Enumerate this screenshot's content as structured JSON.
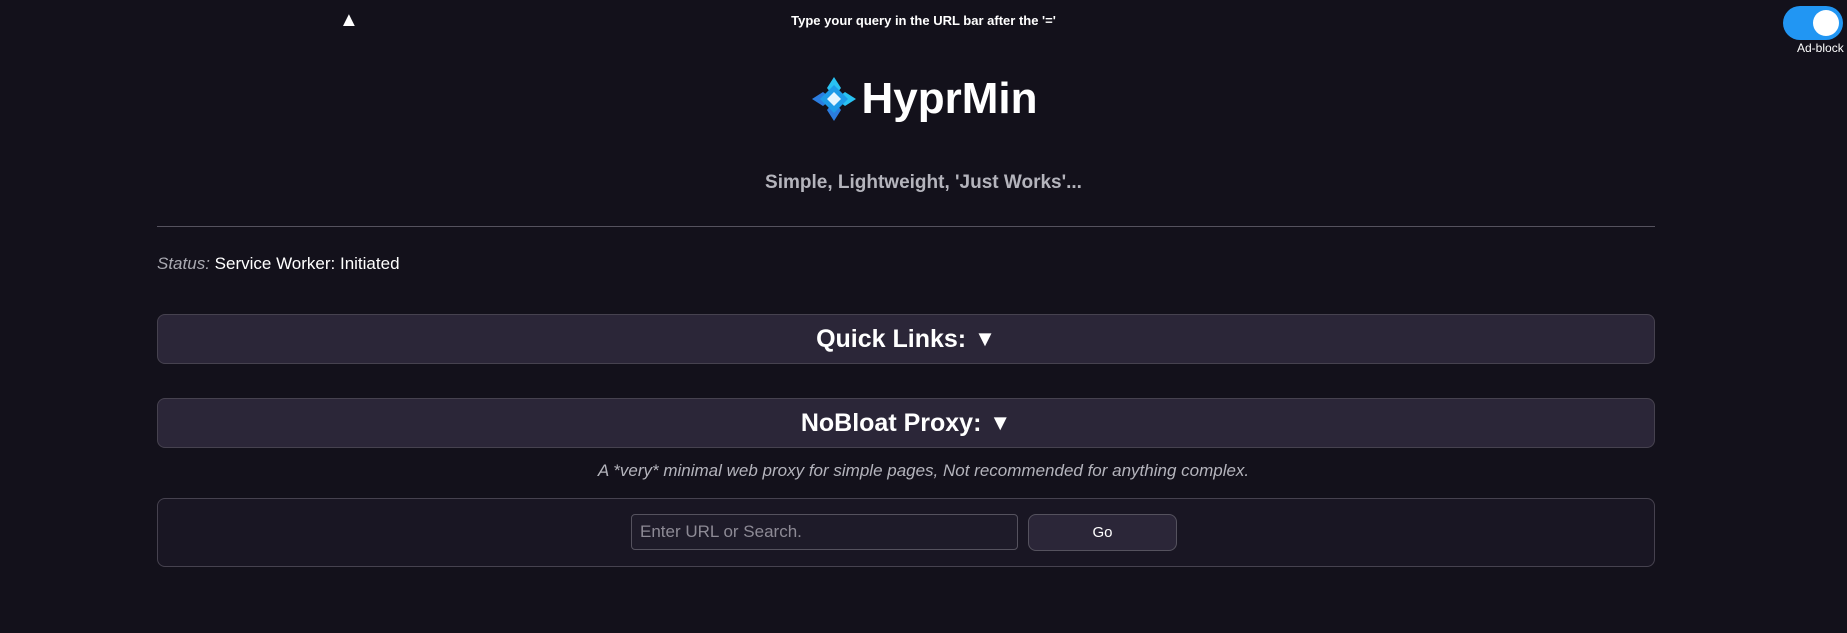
{
  "top": {
    "up_arrow": "▲",
    "hint": "Type your query in the URL bar after the '='",
    "adblock_label": "Ad-block",
    "adblock_on": true
  },
  "brand": {
    "name": "HyprMin",
    "logo_icon": "diamond-flower-icon"
  },
  "tagline": "Simple, Lightweight, 'Just Works'...",
  "status": {
    "label": "Status:",
    "value": "Service Worker: Initiated"
  },
  "sections": {
    "quick_links": "Quick Links:",
    "nobloat": "NoBloat Proxy:",
    "arrow": "▼"
  },
  "proxy": {
    "description": "A *very* minimal web proxy for simple pages, Not recommended for anything complex.",
    "placeholder": "Enter URL or Search.",
    "value": "",
    "go_label": "Go"
  },
  "colors": {
    "background": "#13111b",
    "accent": "#2196f3",
    "panel": "#2b2638",
    "logo_cyan": "#29c2f2",
    "logo_blue": "#2b7de0"
  }
}
